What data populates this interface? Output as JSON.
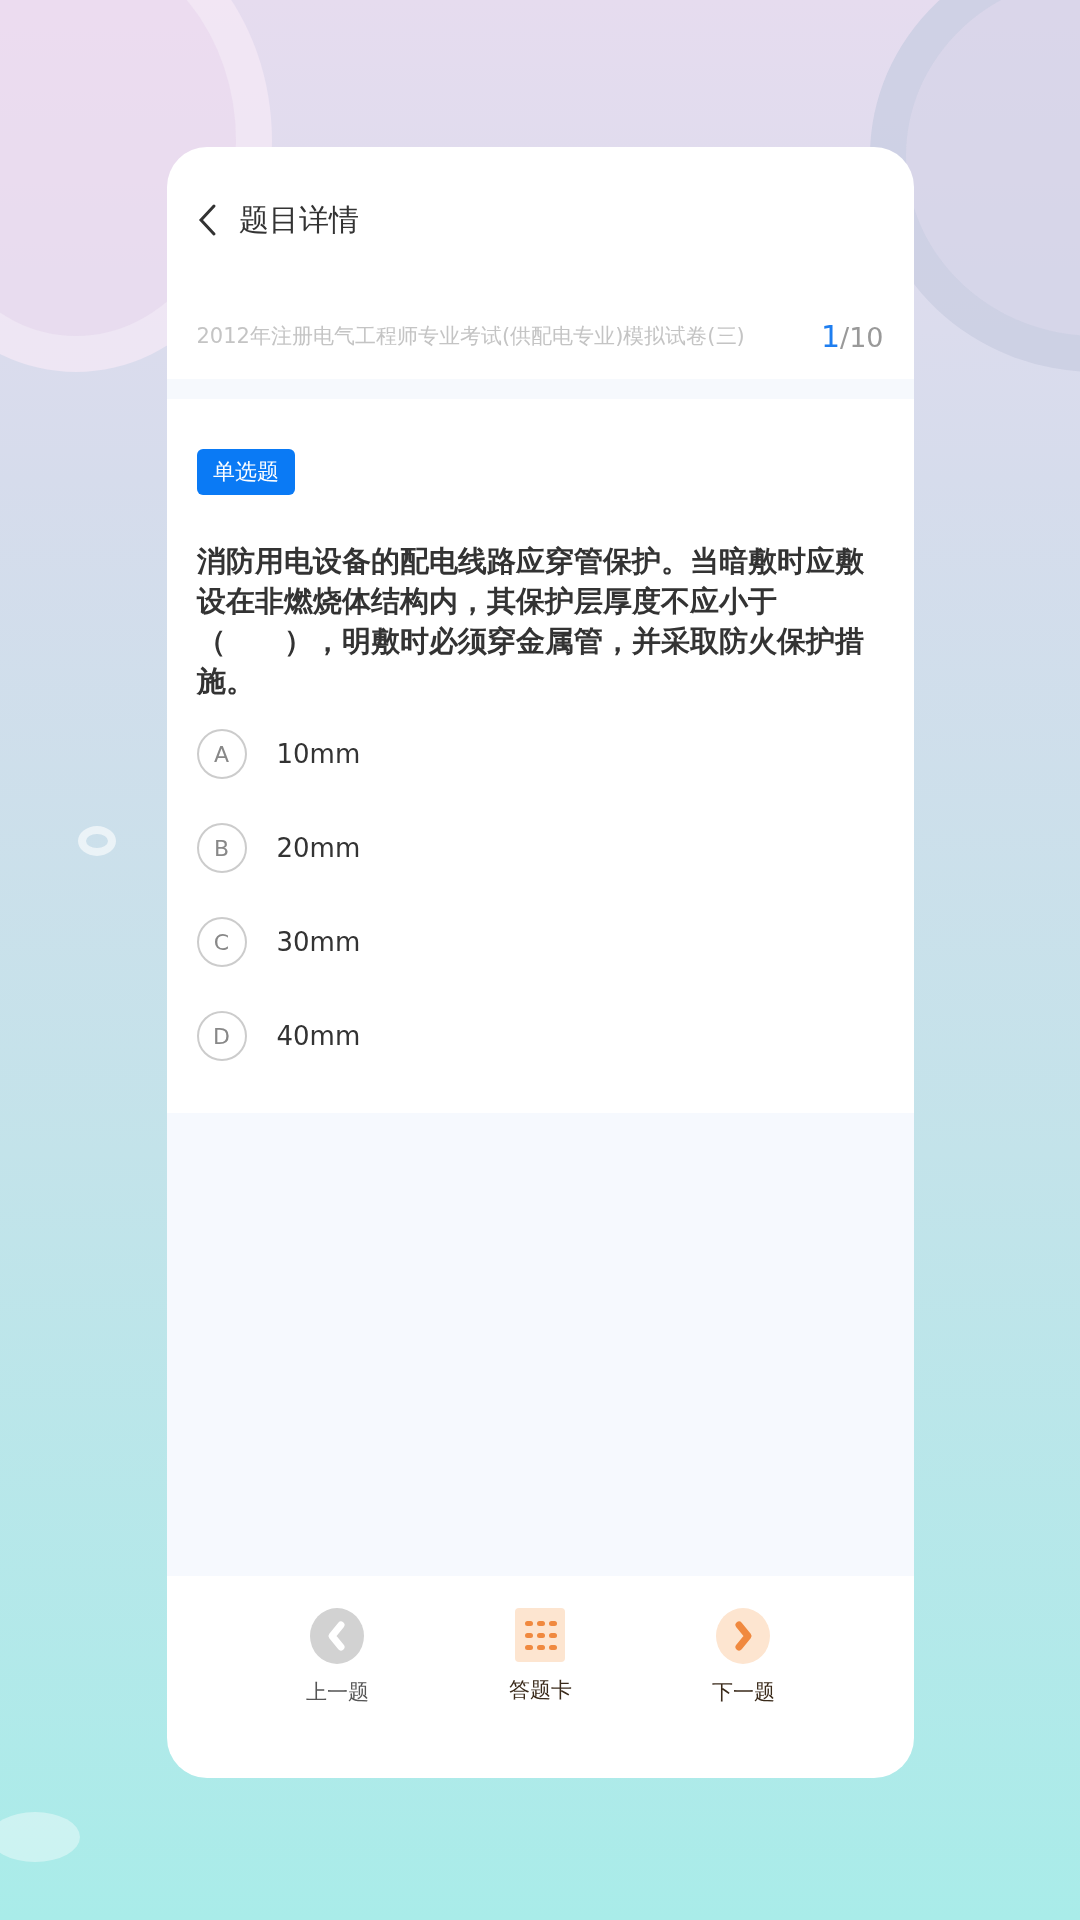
{
  "header": {
    "title": "题目详情"
  },
  "paper": {
    "title": "2012年注册电气工程师专业考试(供配电专业)模拟试卷(三)",
    "current": "1",
    "total": "/10"
  },
  "question": {
    "type": "单选题",
    "text": "消防用电设备的配电线路应穿管保护。当暗敷时应敷设在非燃烧体结构内，其保护层厚度不应小于（　　），明敷时必须穿金属管，并采取防火保护措施。",
    "options": [
      {
        "letter": "A",
        "text": "10mm",
        "selected": false
      },
      {
        "letter": "B",
        "text": "20mm",
        "selected": false
      },
      {
        "letter": "C",
        "text": "30mm",
        "selected": false
      },
      {
        "letter": "D",
        "text": "40mm",
        "selected": false
      }
    ]
  },
  "bottom_nav": [
    {
      "kind": "prev",
      "label": "上一题",
      "disabled": true
    },
    {
      "kind": "card",
      "label": "答题卡",
      "disabled": false
    },
    {
      "kind": "next",
      "label": "下一题",
      "disabled": false
    }
  ]
}
